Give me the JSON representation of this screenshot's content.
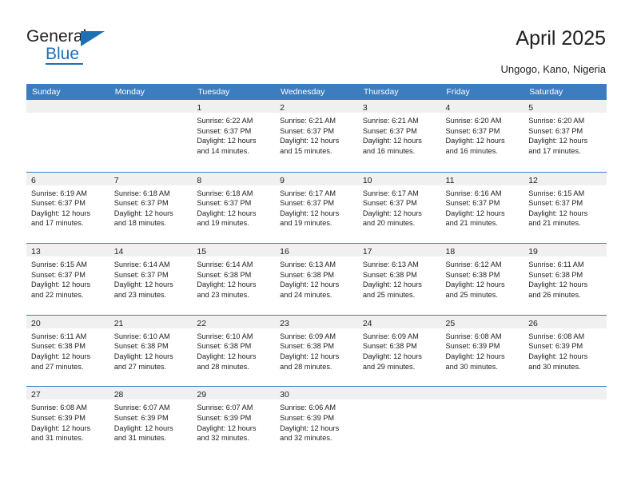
{
  "brand": {
    "name_part1": "General",
    "name_part2": "Blue"
  },
  "header": {
    "title": "April 2025",
    "location": "Ungogo, Kano, Nigeria"
  },
  "colors": {
    "header_blue": "#3b7dbf",
    "day_band_gray": "#f0f0f0",
    "brand_blue": "#1f6fb5",
    "text": "#222222"
  },
  "weekday_headers": [
    "Sunday",
    "Monday",
    "Tuesday",
    "Wednesday",
    "Thursday",
    "Friday",
    "Saturday"
  ],
  "weeks": [
    [
      {
        "day": "",
        "lines": [
          "",
          "",
          "",
          ""
        ]
      },
      {
        "day": "",
        "lines": [
          "",
          "",
          "",
          ""
        ]
      },
      {
        "day": "1",
        "lines": [
          "Sunrise: 6:22 AM",
          "Sunset: 6:37 PM",
          "Daylight: 12 hours",
          "and 14 minutes."
        ]
      },
      {
        "day": "2",
        "lines": [
          "Sunrise: 6:21 AM",
          "Sunset: 6:37 PM",
          "Daylight: 12 hours",
          "and 15 minutes."
        ]
      },
      {
        "day": "3",
        "lines": [
          "Sunrise: 6:21 AM",
          "Sunset: 6:37 PM",
          "Daylight: 12 hours",
          "and 16 minutes."
        ]
      },
      {
        "day": "4",
        "lines": [
          "Sunrise: 6:20 AM",
          "Sunset: 6:37 PM",
          "Daylight: 12 hours",
          "and 16 minutes."
        ]
      },
      {
        "day": "5",
        "lines": [
          "Sunrise: 6:20 AM",
          "Sunset: 6:37 PM",
          "Daylight: 12 hours",
          "and 17 minutes."
        ]
      }
    ],
    [
      {
        "day": "6",
        "lines": [
          "Sunrise: 6:19 AM",
          "Sunset: 6:37 PM",
          "Daylight: 12 hours",
          "and 17 minutes."
        ]
      },
      {
        "day": "7",
        "lines": [
          "Sunrise: 6:18 AM",
          "Sunset: 6:37 PM",
          "Daylight: 12 hours",
          "and 18 minutes."
        ]
      },
      {
        "day": "8",
        "lines": [
          "Sunrise: 6:18 AM",
          "Sunset: 6:37 PM",
          "Daylight: 12 hours",
          "and 19 minutes."
        ]
      },
      {
        "day": "9",
        "lines": [
          "Sunrise: 6:17 AM",
          "Sunset: 6:37 PM",
          "Daylight: 12 hours",
          "and 19 minutes."
        ]
      },
      {
        "day": "10",
        "lines": [
          "Sunrise: 6:17 AM",
          "Sunset: 6:37 PM",
          "Daylight: 12 hours",
          "and 20 minutes."
        ]
      },
      {
        "day": "11",
        "lines": [
          "Sunrise: 6:16 AM",
          "Sunset: 6:37 PM",
          "Daylight: 12 hours",
          "and 21 minutes."
        ]
      },
      {
        "day": "12",
        "lines": [
          "Sunrise: 6:15 AM",
          "Sunset: 6:37 PM",
          "Daylight: 12 hours",
          "and 21 minutes."
        ]
      }
    ],
    [
      {
        "day": "13",
        "lines": [
          "Sunrise: 6:15 AM",
          "Sunset: 6:37 PM",
          "Daylight: 12 hours",
          "and 22 minutes."
        ]
      },
      {
        "day": "14",
        "lines": [
          "Sunrise: 6:14 AM",
          "Sunset: 6:37 PM",
          "Daylight: 12 hours",
          "and 23 minutes."
        ]
      },
      {
        "day": "15",
        "lines": [
          "Sunrise: 6:14 AM",
          "Sunset: 6:38 PM",
          "Daylight: 12 hours",
          "and 23 minutes."
        ]
      },
      {
        "day": "16",
        "lines": [
          "Sunrise: 6:13 AM",
          "Sunset: 6:38 PM",
          "Daylight: 12 hours",
          "and 24 minutes."
        ]
      },
      {
        "day": "17",
        "lines": [
          "Sunrise: 6:13 AM",
          "Sunset: 6:38 PM",
          "Daylight: 12 hours",
          "and 25 minutes."
        ]
      },
      {
        "day": "18",
        "lines": [
          "Sunrise: 6:12 AM",
          "Sunset: 6:38 PM",
          "Daylight: 12 hours",
          "and 25 minutes."
        ]
      },
      {
        "day": "19",
        "lines": [
          "Sunrise: 6:11 AM",
          "Sunset: 6:38 PM",
          "Daylight: 12 hours",
          "and 26 minutes."
        ]
      }
    ],
    [
      {
        "day": "20",
        "lines": [
          "Sunrise: 6:11 AM",
          "Sunset: 6:38 PM",
          "Daylight: 12 hours",
          "and 27 minutes."
        ]
      },
      {
        "day": "21",
        "lines": [
          "Sunrise: 6:10 AM",
          "Sunset: 6:38 PM",
          "Daylight: 12 hours",
          "and 27 minutes."
        ]
      },
      {
        "day": "22",
        "lines": [
          "Sunrise: 6:10 AM",
          "Sunset: 6:38 PM",
          "Daylight: 12 hours",
          "and 28 minutes."
        ]
      },
      {
        "day": "23",
        "lines": [
          "Sunrise: 6:09 AM",
          "Sunset: 6:38 PM",
          "Daylight: 12 hours",
          "and 28 minutes."
        ]
      },
      {
        "day": "24",
        "lines": [
          "Sunrise: 6:09 AM",
          "Sunset: 6:38 PM",
          "Daylight: 12 hours",
          "and 29 minutes."
        ]
      },
      {
        "day": "25",
        "lines": [
          "Sunrise: 6:08 AM",
          "Sunset: 6:39 PM",
          "Daylight: 12 hours",
          "and 30 minutes."
        ]
      },
      {
        "day": "26",
        "lines": [
          "Sunrise: 6:08 AM",
          "Sunset: 6:39 PM",
          "Daylight: 12 hours",
          "and 30 minutes."
        ]
      }
    ],
    [
      {
        "day": "27",
        "lines": [
          "Sunrise: 6:08 AM",
          "Sunset: 6:39 PM",
          "Daylight: 12 hours",
          "and 31 minutes."
        ]
      },
      {
        "day": "28",
        "lines": [
          "Sunrise: 6:07 AM",
          "Sunset: 6:39 PM",
          "Daylight: 12 hours",
          "and 31 minutes."
        ]
      },
      {
        "day": "29",
        "lines": [
          "Sunrise: 6:07 AM",
          "Sunset: 6:39 PM",
          "Daylight: 12 hours",
          "and 32 minutes."
        ]
      },
      {
        "day": "30",
        "lines": [
          "Sunrise: 6:06 AM",
          "Sunset: 6:39 PM",
          "Daylight: 12 hours",
          "and 32 minutes."
        ]
      },
      {
        "day": "",
        "lines": [
          "",
          "",
          "",
          ""
        ]
      },
      {
        "day": "",
        "lines": [
          "",
          "",
          "",
          ""
        ]
      },
      {
        "day": "",
        "lines": [
          "",
          "",
          "",
          ""
        ]
      }
    ]
  ]
}
